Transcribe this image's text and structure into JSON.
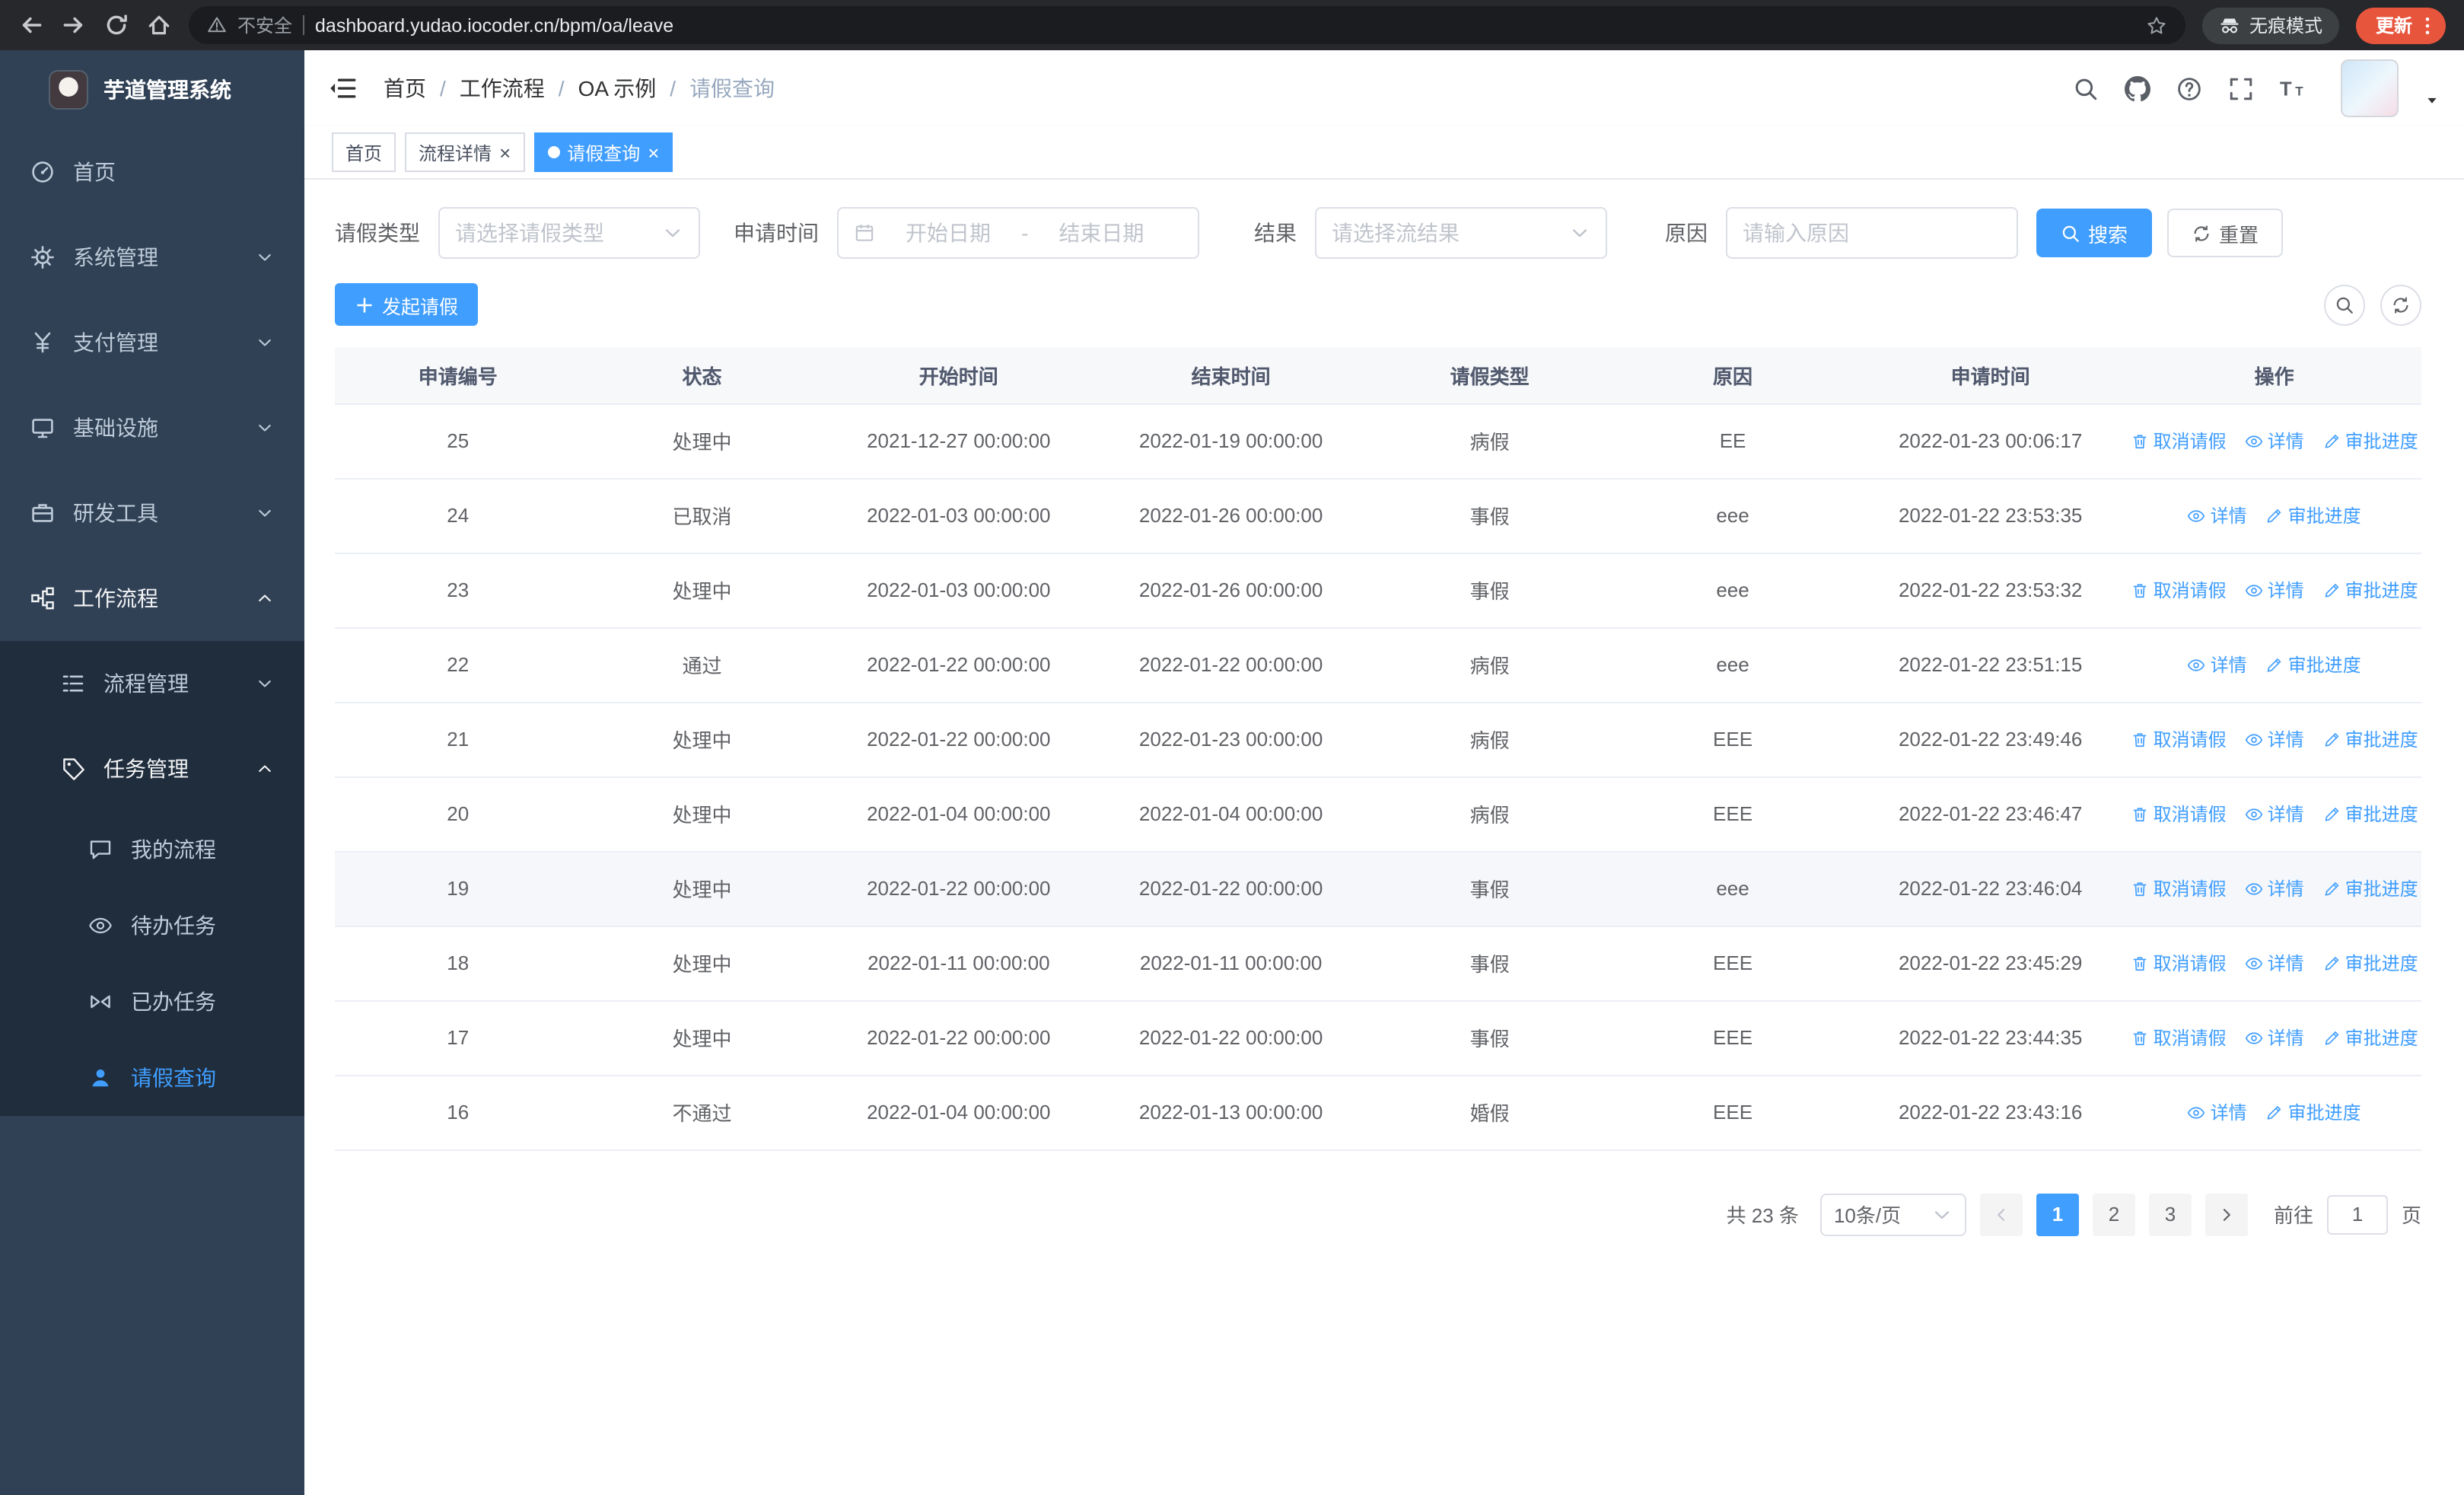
{
  "colors": {
    "primary": "#409eff",
    "sidebar_bg": "#304156",
    "sidebar_submenu_bg": "#1f2d3d",
    "update_pill": "#e8553d"
  },
  "browser": {
    "security_label": "不安全",
    "url": "dashboard.yudao.iocoder.cn/bpm/oa/leave",
    "incognito_label": "无痕模式",
    "update_label": "更新"
  },
  "sidebar": {
    "app_title": "芋道管理系统",
    "items": [
      {
        "label": "首页",
        "icon": "dashboard-icon",
        "level": 1
      },
      {
        "label": "系统管理",
        "icon": "gear-icon",
        "level": 1,
        "arrow": "down"
      },
      {
        "label": "支付管理",
        "icon": "payment-icon",
        "level": 1,
        "arrow": "down"
      },
      {
        "label": "基础设施",
        "icon": "infra-icon",
        "level": 1,
        "arrow": "down"
      },
      {
        "label": "研发工具",
        "icon": "tools-icon",
        "level": 1,
        "arrow": "down"
      },
      {
        "label": "工作流程",
        "icon": "workflow-icon",
        "level": 1,
        "arrow": "up",
        "bright": true
      },
      {
        "label": "流程管理",
        "icon": "process-icon",
        "level": 2,
        "arrow": "down",
        "sub": true
      },
      {
        "label": "任务管理",
        "icon": "task-icon",
        "level": 2,
        "arrow": "up",
        "sub": true,
        "bright": true
      },
      {
        "label": "我的流程",
        "icon": "chat-icon",
        "level": 3,
        "sub": true
      },
      {
        "label": "待办任务",
        "icon": "eye-icon",
        "level": 3,
        "sub": true
      },
      {
        "label": "已办任务",
        "icon": "done-icon",
        "level": 3,
        "sub": true
      },
      {
        "label": "请假查询",
        "icon": "user-icon",
        "level": 3,
        "sub": true,
        "active": true
      }
    ]
  },
  "breadcrumb": {
    "separator": "/",
    "items": [
      "首页",
      "工作流程",
      "OA 示例",
      "请假查询"
    ]
  },
  "tabs": [
    {
      "label": "首页",
      "active": false,
      "closable": false
    },
    {
      "label": "流程详情",
      "active": false,
      "closable": true
    },
    {
      "label": "请假查询",
      "active": true,
      "closable": true
    }
  ],
  "filters": {
    "leave_type_label": "请假类型",
    "leave_type_placeholder": "请选择请假类型",
    "apply_time_label": "申请时间",
    "start_date_placeholder": "开始日期",
    "range_separator": "-",
    "end_date_placeholder": "结束日期",
    "result_label": "结果",
    "result_placeholder": "请选择流结果",
    "reason_label": "原因",
    "reason_placeholder": "请输入原因",
    "search_button": "搜索",
    "reset_button": "重置"
  },
  "toolbar": {
    "create_button": "发起请假"
  },
  "table": {
    "columns": [
      "申请编号",
      "状态",
      "开始时间",
      "结束时间",
      "请假类型",
      "原因",
      "申请时间",
      "操作"
    ],
    "action_labels": {
      "cancel": "取消请假",
      "detail": "详情",
      "progress": "审批进度"
    },
    "rows": [
      {
        "id": "25",
        "status": "处理中",
        "start": "2021-12-27 00:00:00",
        "end": "2022-01-19 00:00:00",
        "type": "病假",
        "reason": "EE",
        "apply_time": "2022-01-23 00:06:17",
        "cancelable": true
      },
      {
        "id": "24",
        "status": "已取消",
        "start": "2022-01-03 00:00:00",
        "end": "2022-01-26 00:00:00",
        "type": "事假",
        "reason": "eee",
        "apply_time": "2022-01-22 23:53:35",
        "cancelable": false
      },
      {
        "id": "23",
        "status": "处理中",
        "start": "2022-01-03 00:00:00",
        "end": "2022-01-26 00:00:00",
        "type": "事假",
        "reason": "eee",
        "apply_time": "2022-01-22 23:53:32",
        "cancelable": true
      },
      {
        "id": "22",
        "status": "通过",
        "start": "2022-01-22 00:00:00",
        "end": "2022-01-22 00:00:00",
        "type": "病假",
        "reason": "eee",
        "apply_time": "2022-01-22 23:51:15",
        "cancelable": false
      },
      {
        "id": "21",
        "status": "处理中",
        "start": "2022-01-22 00:00:00",
        "end": "2022-01-23 00:00:00",
        "type": "病假",
        "reason": "EEE",
        "apply_time": "2022-01-22 23:49:46",
        "cancelable": true
      },
      {
        "id": "20",
        "status": "处理中",
        "start": "2022-01-04 00:00:00",
        "end": "2022-01-04 00:00:00",
        "type": "病假",
        "reason": "EEE",
        "apply_time": "2022-01-22 23:46:47",
        "cancelable": true
      },
      {
        "id": "19",
        "status": "处理中",
        "start": "2022-01-22 00:00:00",
        "end": "2022-01-22 00:00:00",
        "type": "事假",
        "reason": "eee",
        "apply_time": "2022-01-22 23:46:04",
        "cancelable": true,
        "highlighted": true
      },
      {
        "id": "18",
        "status": "处理中",
        "start": "2022-01-11 00:00:00",
        "end": "2022-01-11 00:00:00",
        "type": "事假",
        "reason": "EEE",
        "apply_time": "2022-01-22 23:45:29",
        "cancelable": true
      },
      {
        "id": "17",
        "status": "处理中",
        "start": "2022-01-22 00:00:00",
        "end": "2022-01-22 00:00:00",
        "type": "事假",
        "reason": "EEE",
        "apply_time": "2022-01-22 23:44:35",
        "cancelable": true
      },
      {
        "id": "16",
        "status": "不通过",
        "start": "2022-01-04 00:00:00",
        "end": "2022-01-13 00:00:00",
        "type": "婚假",
        "reason": "EEE",
        "apply_time": "2022-01-22 23:43:16",
        "cancelable": false
      }
    ]
  },
  "pagination": {
    "total": "共 23 条",
    "page_size": "10条/页",
    "pages": [
      "1",
      "2",
      "3"
    ],
    "active_page": "1",
    "goto_label": "前往",
    "goto_value": "1",
    "unit_label": "页"
  }
}
